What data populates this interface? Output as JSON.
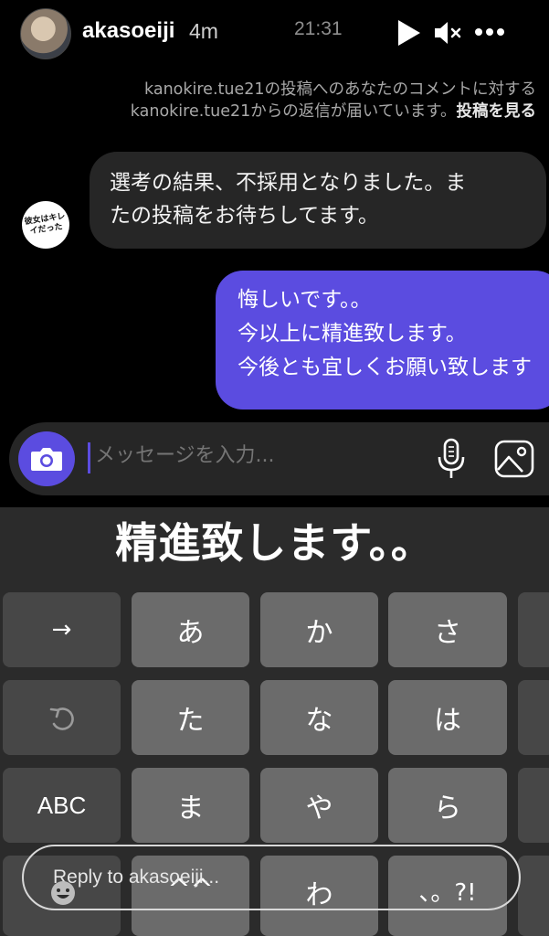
{
  "header": {
    "username": "akasoeiji",
    "time_ago": "4m",
    "clock": "21:31"
  },
  "notice": {
    "line1": "kanokire.tue21の投稿へのあなたのコメントに対する",
    "line2_prefix": "kanokire.tue21からの返信が届いています。",
    "see_post": "投稿を見る"
  },
  "chat": {
    "received_avatar_text": "彼女はキレイだった",
    "received": [
      "選考の結果、不採用となりました。ま",
      "たの投稿をお待ちしてます。"
    ],
    "sent": [
      "悔しいです。。",
      "今以上に精進致します。",
      "今後とも宜しくお願い致します"
    ]
  },
  "composer": {
    "placeholder": "メッセージを入力..."
  },
  "keyboard": {
    "candidate": "精進致します。。",
    "rows": [
      [
        "→",
        "あ",
        "か",
        "さ"
      ],
      [
        "undo",
        "た",
        "な",
        "は"
      ],
      [
        "ABC",
        "ま",
        "や",
        "ら"
      ],
      [
        "",
        "^^",
        "わ",
        "、。?!"
      ]
    ]
  },
  "reply": {
    "placeholder": "Reply to akasoeiji..."
  },
  "colors": {
    "accent": "#5b4ce0",
    "bubble_received": "#262626",
    "keyboard_bg": "#2b2b2b",
    "key": "#6b6b6b",
    "key_function": "#474747"
  }
}
